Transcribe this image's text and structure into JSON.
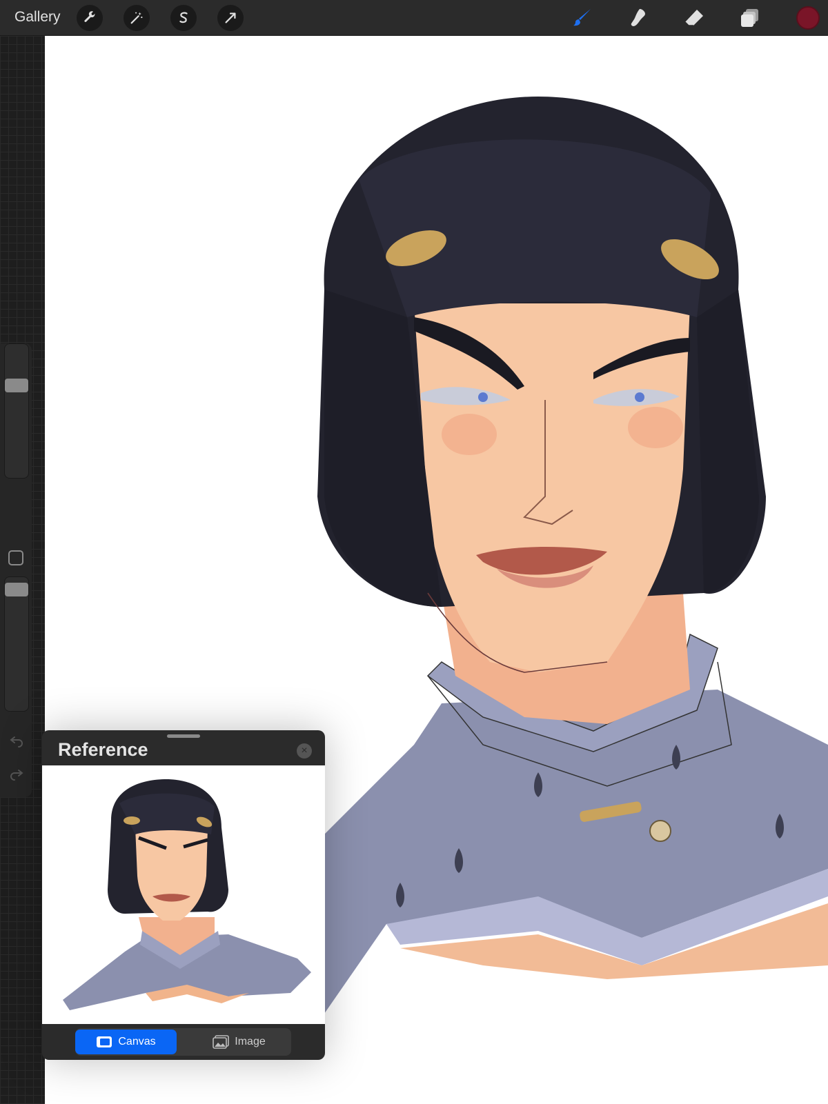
{
  "toolbar": {
    "gallery_label": "Gallery",
    "left_tools": [
      "wrench-icon",
      "magic-wand-icon",
      "selection-s-icon",
      "arrow-transform-icon"
    ],
    "right_tools": [
      "brush-icon",
      "smudge-icon",
      "eraser-icon",
      "layers-icon"
    ],
    "active_tool": "brush-icon",
    "accent_color": "#1e6ff0",
    "current_color": "#7a1528"
  },
  "sidebar": {
    "brush_size_level": 0.72,
    "opacity_level": 0.96
  },
  "reference_panel": {
    "title": "Reference",
    "tabs": [
      {
        "label": "Canvas",
        "icon": "canvas-icon",
        "active": true
      },
      {
        "label": "Image",
        "icon": "image-icon",
        "active": false
      }
    ],
    "active_color": "#0a66f5"
  },
  "canvas": {
    "subject": "illustration-portrait"
  }
}
